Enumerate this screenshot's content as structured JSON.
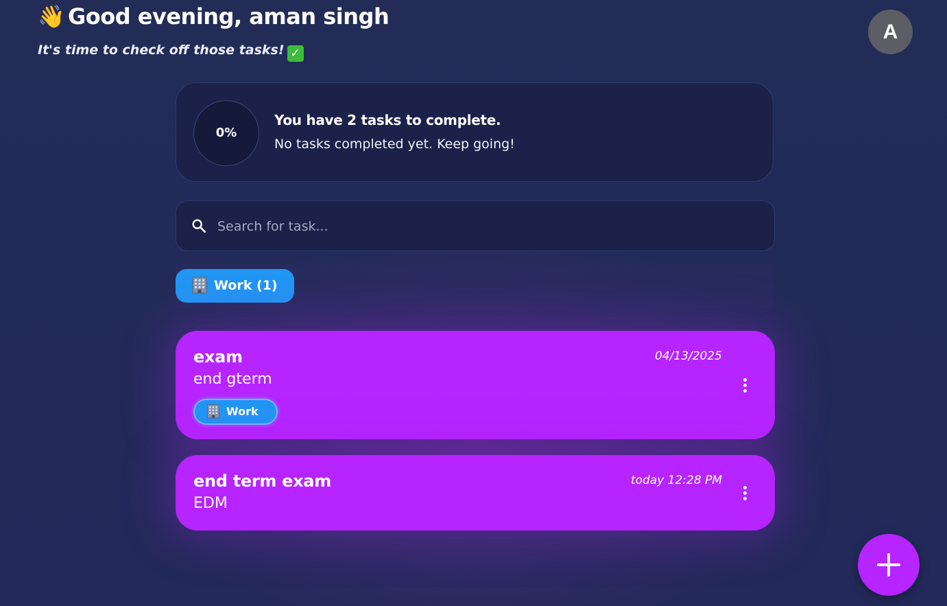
{
  "header": {
    "wave_emoji": "👋",
    "greeting": "Good evening, aman singh",
    "subtitle": "It's time to check off those tasks!",
    "subtitle_check": "✓",
    "avatar_initial": "A"
  },
  "summary": {
    "progress_percent": "0%",
    "progress_value": 0,
    "title": "You have 2 tasks to complete.",
    "message": "No tasks completed yet. Keep going!"
  },
  "search": {
    "placeholder": "Search for task..."
  },
  "categories": [
    {
      "label": "Work (1)",
      "icon": "office-building-icon",
      "color": "#2196f3"
    }
  ],
  "tasks": [
    {
      "title": "exam",
      "description": "end gterm",
      "date": "04/13/2025",
      "tag": "Work",
      "tag_icon": "office-building-icon",
      "color": "#b624ff"
    },
    {
      "title": "end term exam",
      "description": "EDM",
      "date": "today 12:28 PM",
      "color": "#b624ff"
    }
  ],
  "colors": {
    "background": "#232a58",
    "card": "#1b2148",
    "accent_purple": "#b624ff",
    "accent_blue": "#2196f3"
  }
}
